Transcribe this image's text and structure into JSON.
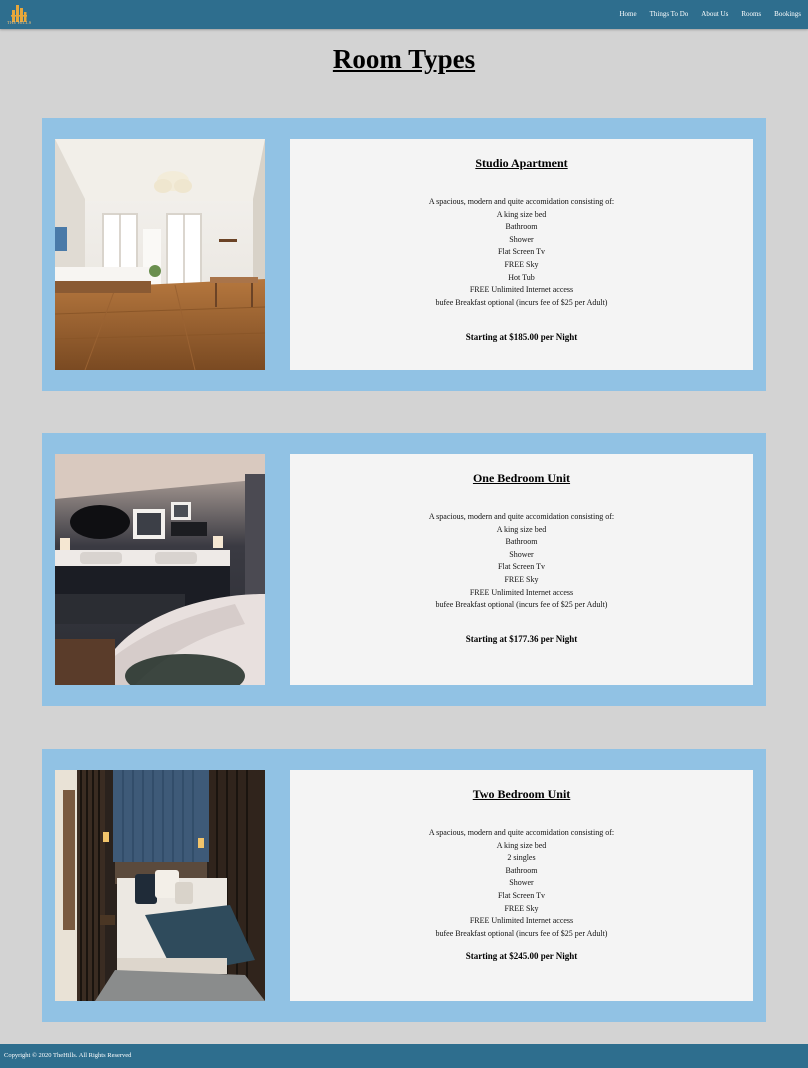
{
  "brand": {
    "logo_text": "THE HILLS",
    "gold": "#e7a73b",
    "bar_color": "#2e6e8e"
  },
  "nav": [
    {
      "label": "Home"
    },
    {
      "label": "Things To Do"
    },
    {
      "label": "About Us"
    },
    {
      "label": "Rooms"
    },
    {
      "label": "Bookings"
    }
  ],
  "page": {
    "title": "Room Types"
  },
  "rooms": [
    {
      "title": "Studio Apartment",
      "photo_icon": "studio-apartment-photo",
      "lines": [
        "A spacious, modern and quite accomidation consisting of:",
        "A king size bed",
        "Bathroom",
        "Shower",
        "Flat Screen Tv",
        "FREE Sky",
        "Hot Tub",
        "FREE Unlimited Internet access",
        "bufee Breakfast optional (incurs fee of $25 per Adult)"
      ],
      "price": "Starting at $185.00 per Night"
    },
    {
      "title": "One Bedroom Unit",
      "photo_icon": "one-bedroom-photo",
      "lines": [
        "A spacious, modern and quite accomidation consisting of:",
        "A king size bed",
        "Bathroom",
        "Shower",
        "Flat Screen Tv",
        "FREE Sky",
        "FREE Unlimited Internet access",
        "bufee Breakfast optional (incurs fee of $25 per Adult)"
      ],
      "price": "Starting at $177.36 per Night"
    },
    {
      "title": "Two Bedroom Unit",
      "photo_icon": "two-bedroom-photo",
      "lines": [
        "A spacious, modern and quite accomidation consisting of:",
        "A king size bed",
        "2 singles",
        "Bathroom",
        "Shower",
        "Flat Screen Tv",
        "FREE Sky",
        "FREE Unlimited Internet access",
        "bufee Breakfast optional (incurs fee of $25 per Adult)"
      ],
      "price": "Starting at $245.00 per Night"
    }
  ],
  "footer": {
    "copyright": "Copyright © 2020 TheHills. All Rights Reserved"
  }
}
